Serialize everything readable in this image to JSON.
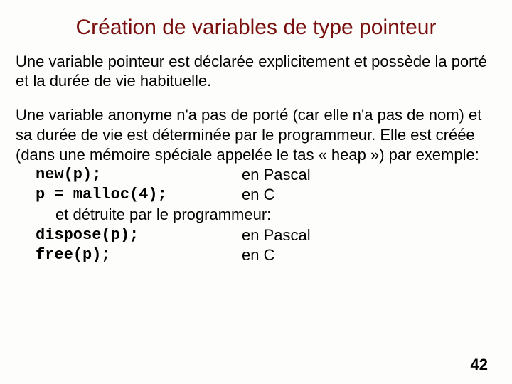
{
  "title": "Création de variables de type pointeur",
  "para1": "Une variable pointeur est déclarée explicitement et possède la porté et la durée de vie habituelle.",
  "para2_a": "Une variable anonyme n'a pas de porté (car elle n'a pas de nom) et sa durée de vie est déterminée par le programmeur. Elle est créée (dans une mémoire spéciale appelée le tas « heap ») par exemple:",
  "rows_create": [
    {
      "code": "new(p);",
      "lang": "en Pascal"
    },
    {
      "code": "p = malloc(4);",
      "lang": "en C"
    }
  ],
  "para2_b": "et détruite par le programmeur:",
  "rows_destroy": [
    {
      "code": "dispose(p);",
      "lang": "en Pascal"
    },
    {
      "code": "free(p);",
      "lang": "en C"
    }
  ],
  "page_number": "42"
}
